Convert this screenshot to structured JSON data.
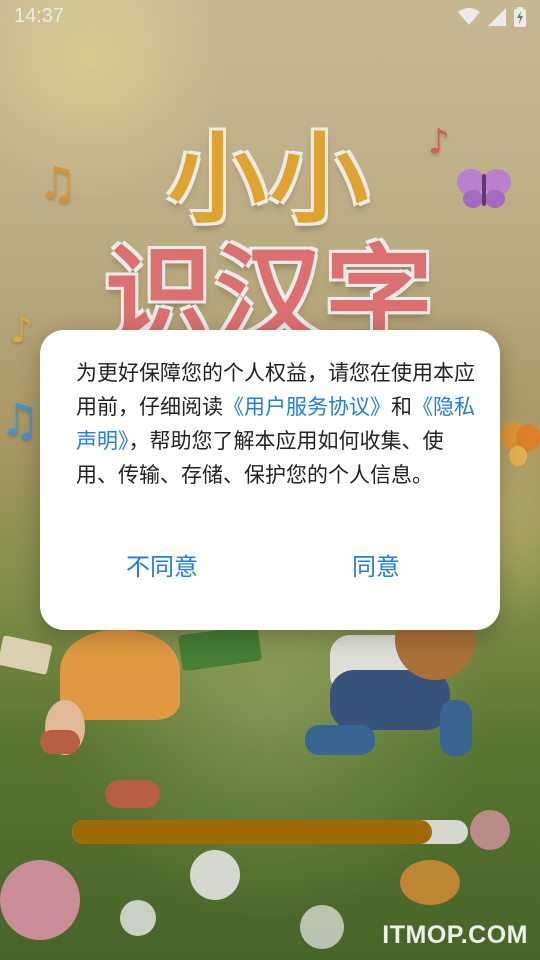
{
  "status_bar": {
    "time": "14:37",
    "icons": [
      "wifi-icon",
      "cellular-signal-icon",
      "battery-charging-icon"
    ]
  },
  "splash": {
    "title_line1": "小小",
    "title_line2": "识汉字",
    "title_colors": [
      "#f2b233",
      "#5ec4e8",
      "#f3b447",
      "#ef7a7a",
      "#8fd35a"
    ]
  },
  "dialog": {
    "text_before": "为更好保障您的个人权益，请您在使用本应用前，仔细阅读",
    "link_user_agreement": "《用户服务协议》",
    "text_and": "和",
    "link_privacy_policy": "《隐私声明》",
    "text_after": "，帮助您了解本应用如何收集、使用、传输、存储、保护您的个人信息。",
    "disagree_label": "不同意",
    "agree_label": "同意",
    "link_color": "#1e7fe0"
  },
  "loading": {
    "progress_fraction": 0.91,
    "fill_color": "#a06a05"
  },
  "watermark": "ITMOP.COM"
}
